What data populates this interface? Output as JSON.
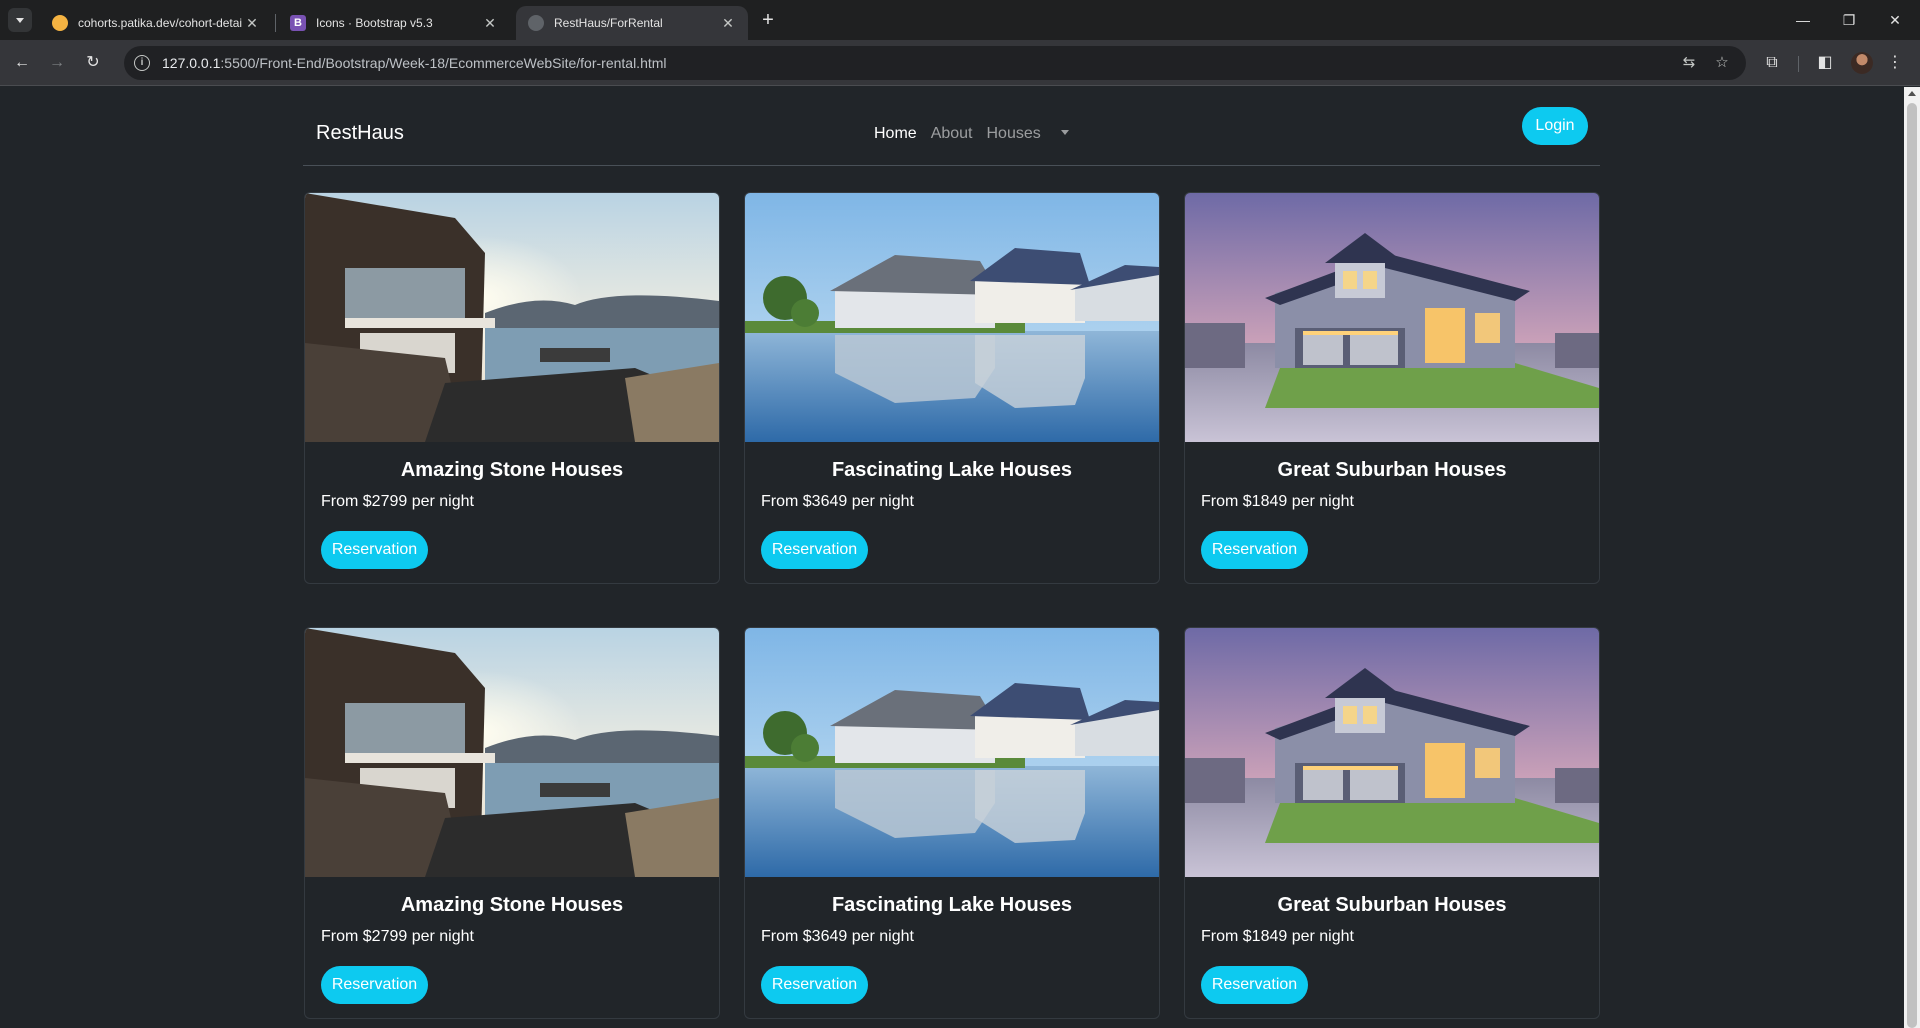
{
  "browser": {
    "tabs": [
      {
        "title": "cohorts.patika.dev/cohort-detai",
        "favicon_color": "#f5b342",
        "active": false
      },
      {
        "title": "Icons · Bootstrap v5.3",
        "favicon_color": "#7952b3",
        "favicon_letter": "B",
        "active": false
      },
      {
        "title": "RestHaus/ForRental",
        "favicon_color": "#5f6368",
        "active": true
      }
    ],
    "url_host": "127.0.0.1",
    "url_path": ":5500/Front-End/Bootstrap/Week-18/EcommerceWebSite/for-rental.html"
  },
  "site": {
    "brand": "RestHaus",
    "nav": {
      "home": "Home",
      "about": "About",
      "houses": "Houses"
    },
    "login": "Login",
    "accent": "#0dcaf0"
  },
  "cards": [
    {
      "title": "Amazing Stone Houses",
      "price": "From $2799 per night",
      "button": "Reservation",
      "image": "stone-house"
    },
    {
      "title": "Fascinating Lake Houses",
      "price": "From $3649 per night",
      "button": "Reservation",
      "image": "lake-house"
    },
    {
      "title": "Great Suburban Houses",
      "price": "From $1849 per night",
      "button": "Reservation",
      "image": "suburban-house"
    },
    {
      "title": "Amazing Stone Houses",
      "price": "From $2799 per night",
      "button": "Reservation",
      "image": "stone-house"
    },
    {
      "title": "Fascinating Lake Houses",
      "price": "From $3649 per night",
      "button": "Reservation",
      "image": "lake-house"
    },
    {
      "title": "Great Suburban Houses",
      "price": "From $1849 per night",
      "button": "Reservation",
      "image": "suburban-house"
    }
  ]
}
